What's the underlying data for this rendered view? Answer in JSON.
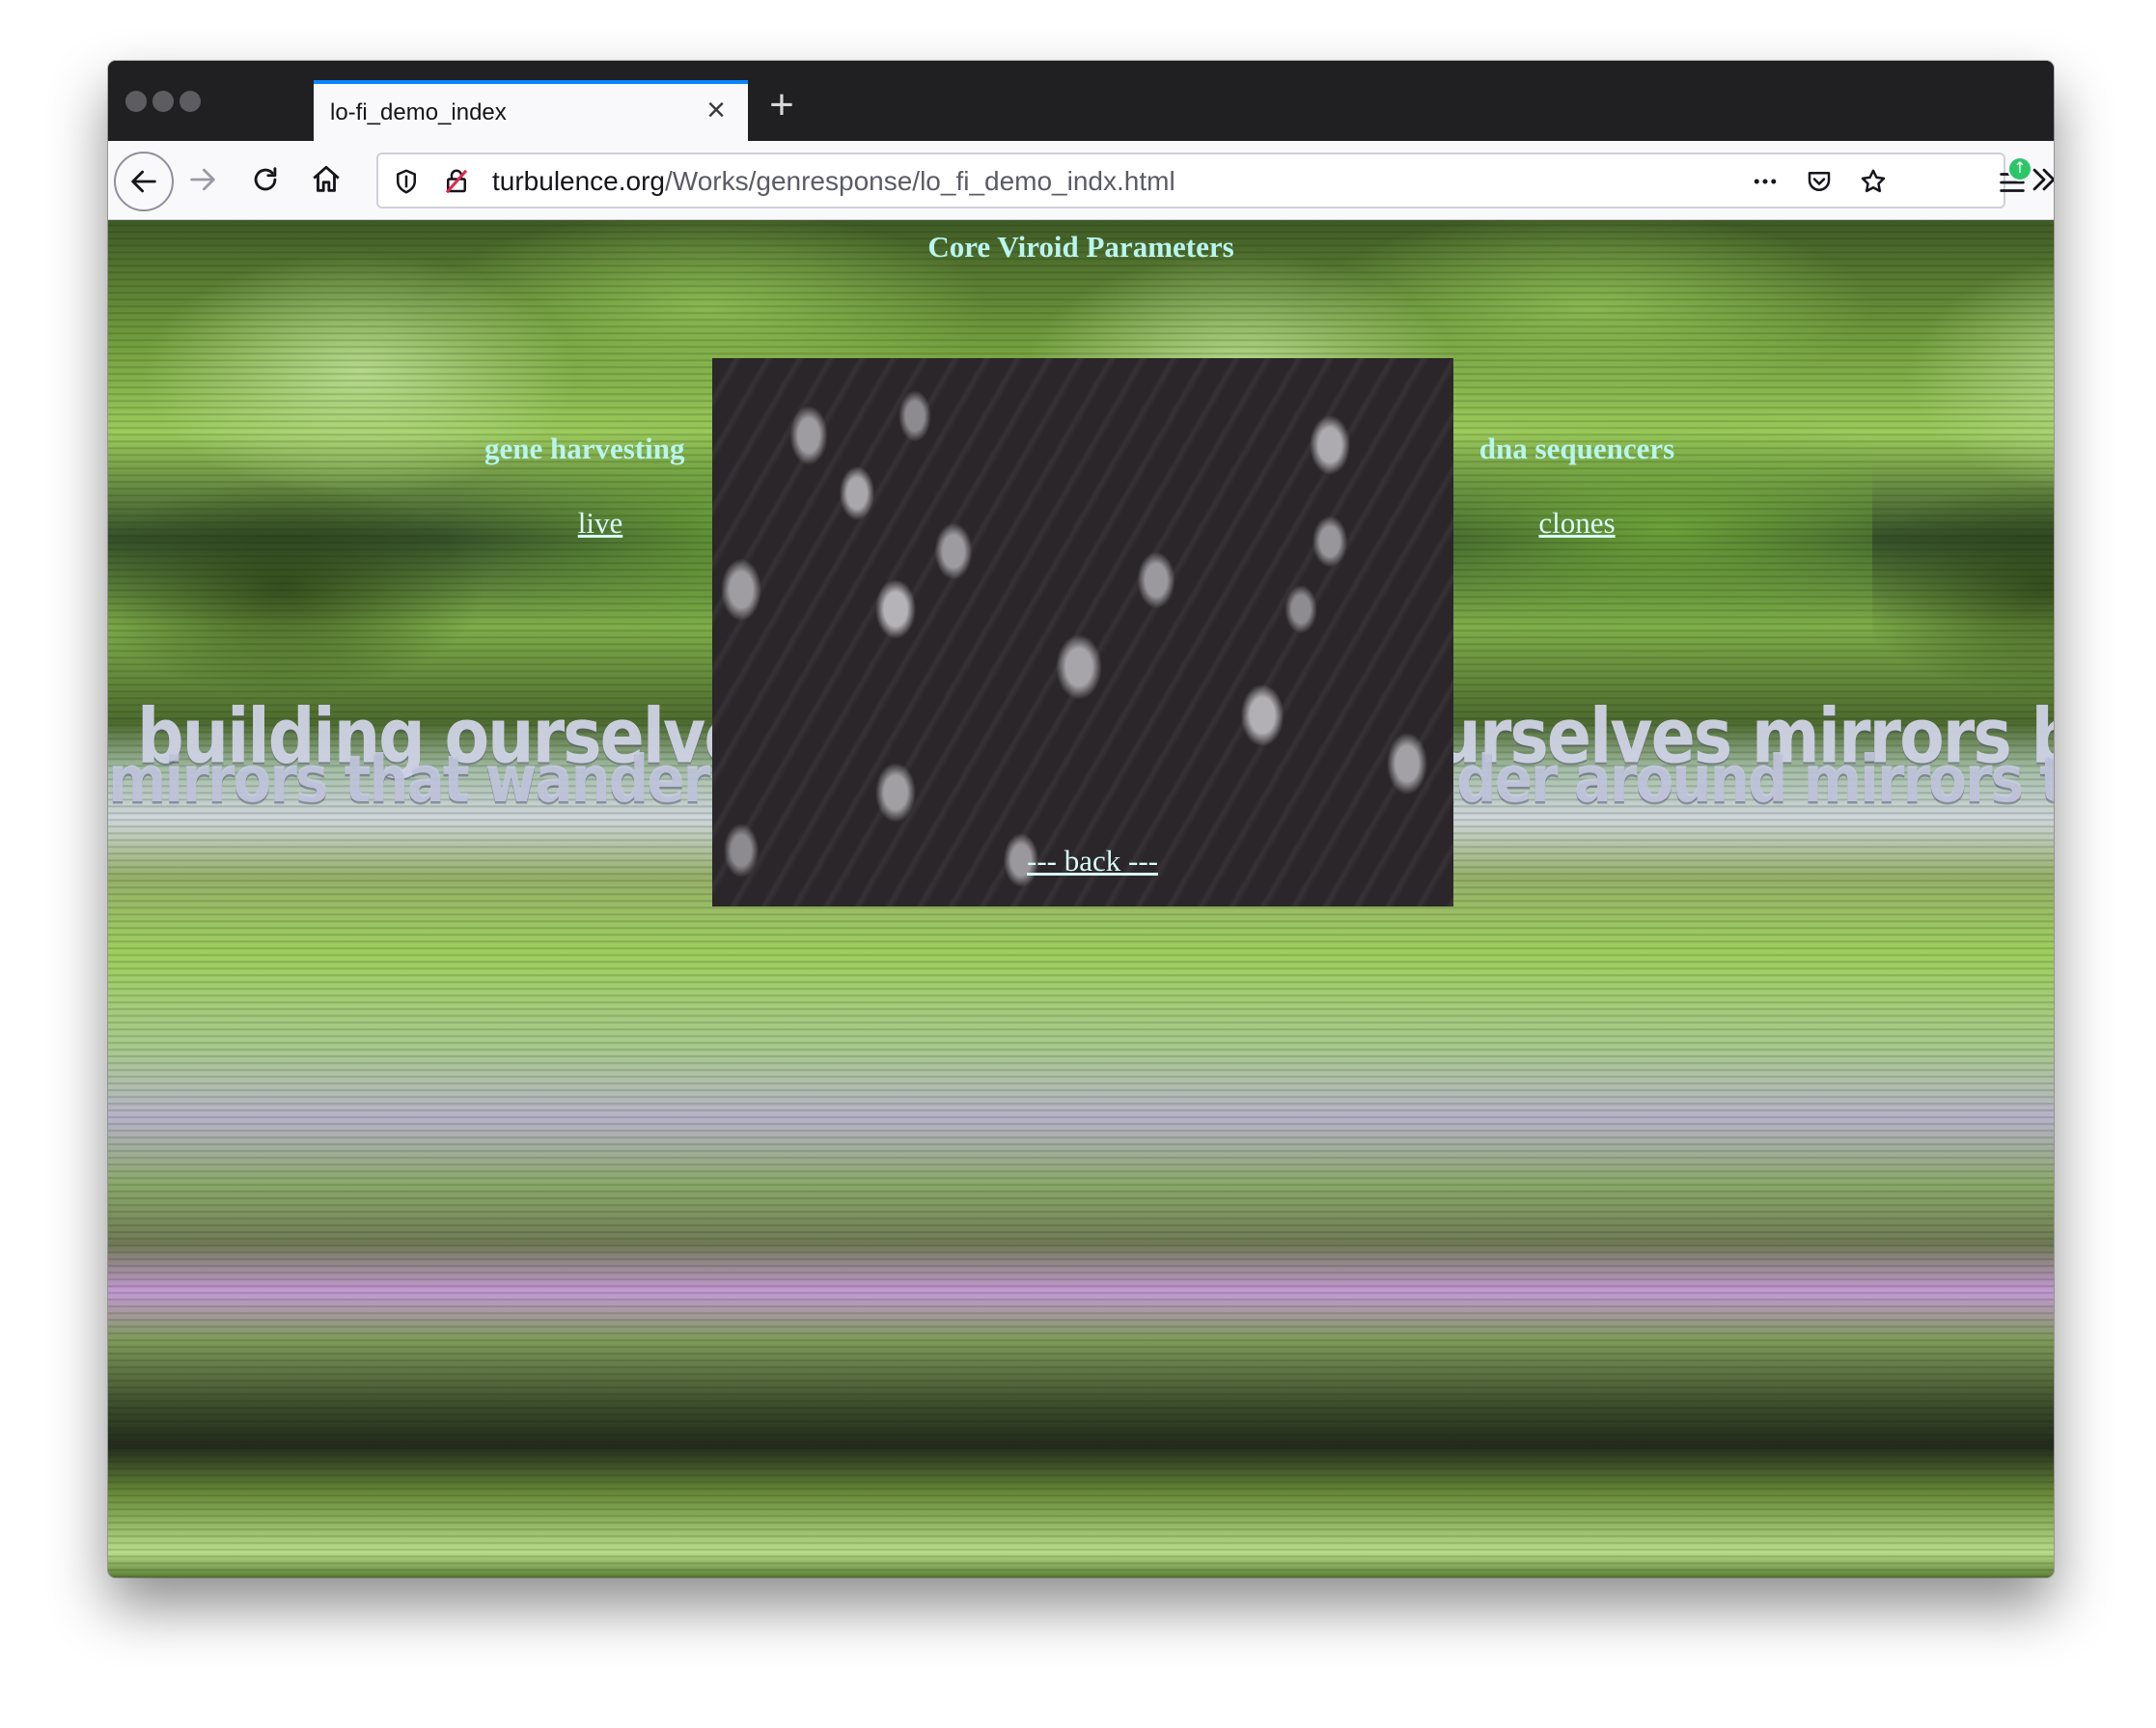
{
  "browser": {
    "tab": {
      "title": "lo-fi_demo_index",
      "close_icon": "close-icon",
      "new_tab_icon": "plus-icon"
    },
    "toolbar": {
      "url_host": "turbulence.org",
      "url_path": "/Works/genresponse/lo_fi_demo_indx.html",
      "icons": [
        "back-arrow-icon",
        "forward-arrow-icon",
        "reload-icon",
        "home-icon",
        "tracking-shield-icon",
        "insecure-lock-icon",
        "more-dots-icon",
        "pocket-icon",
        "bookmark-star-icon",
        "overflow-chevrons-icon",
        "menu-icon"
      ],
      "update_badge_color": "#2ac769",
      "accent_color": "#0a84ff"
    }
  },
  "page": {
    "title": "Core Viroid Parameters",
    "left_heading": "gene harvesting",
    "left_link": "live",
    "right_heading": "dna sequencers",
    "right_link": "clones",
    "back_link": "--- back ---",
    "banner_line_1": "building ourselves mirrors building ourselves mirrors building ourselves mirrors",
    "banner_line_2": "mirrors that wander around mirrors that wander around mirrors that wander around",
    "text_color": "#b9f5ee"
  }
}
